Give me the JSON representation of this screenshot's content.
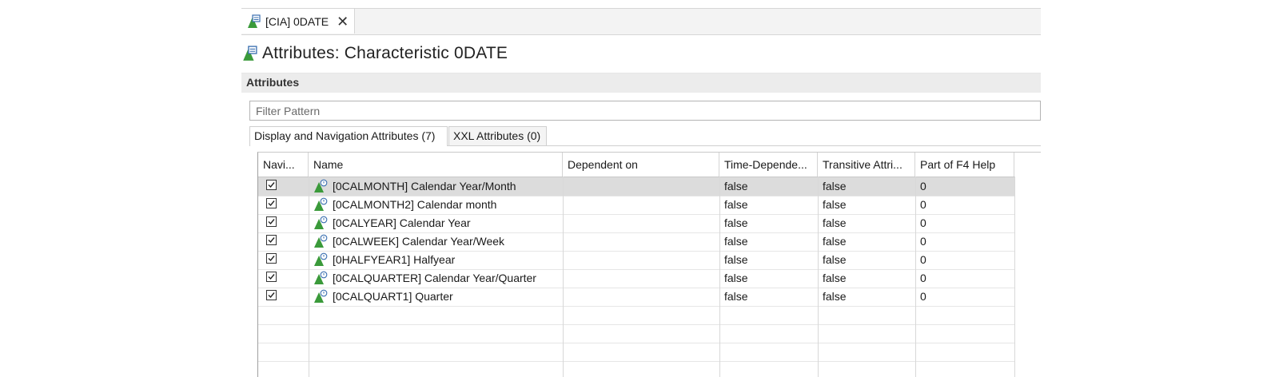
{
  "editor_tab": {
    "label": "[CIA] 0DATE",
    "close_glyph": "✕"
  },
  "page_title": "Attributes: Characteristic 0DATE",
  "section_title": "Attributes",
  "filter": {
    "placeholder": "Filter Pattern"
  },
  "subtabs": [
    {
      "label": "Display and Navigation Attributes (7)",
      "active": true
    },
    {
      "label": "XXL Attributes (0)",
      "active": false
    }
  ],
  "table": {
    "columns": [
      "Navi...",
      "Name",
      "Dependent on",
      "Time-Depende...",
      "Transitive Attri...",
      "Part of F4 Help"
    ],
    "rows": [
      {
        "navigation": true,
        "name": "[0CALMONTH] Calendar Year/Month",
        "dependent_on": "",
        "time_dependent": "false",
        "transitive": "false",
        "f4_help": "0",
        "selected": true
      },
      {
        "navigation": true,
        "name": "[0CALMONTH2] Calendar month",
        "dependent_on": "",
        "time_dependent": "false",
        "transitive": "false",
        "f4_help": "0",
        "selected": false
      },
      {
        "navigation": true,
        "name": "[0CALYEAR] Calendar Year",
        "dependent_on": "",
        "time_dependent": "false",
        "transitive": "false",
        "f4_help": "0",
        "selected": false
      },
      {
        "navigation": true,
        "name": "[0CALWEEK] Calendar Year/Week",
        "dependent_on": "",
        "time_dependent": "false",
        "transitive": "false",
        "f4_help": "0",
        "selected": false
      },
      {
        "navigation": true,
        "name": "[0HALFYEAR1] Halfyear",
        "dependent_on": "",
        "time_dependent": "false",
        "transitive": "false",
        "f4_help": "0",
        "selected": false
      },
      {
        "navigation": true,
        "name": "[0CALQUARTER] Calendar Year/Quarter",
        "dependent_on": "",
        "time_dependent": "false",
        "transitive": "false",
        "f4_help": "0",
        "selected": false
      },
      {
        "navigation": true,
        "name": "[0CALQUART1] Quarter",
        "dependent_on": "",
        "time_dependent": "false",
        "transitive": "false",
        "f4_help": "0",
        "selected": false
      }
    ]
  },
  "icons": {
    "characteristic": "characteristic-icon",
    "attribute": "attribute-icon",
    "checkbox": "checkbox-checked-icon"
  },
  "colors": {
    "icon_green": "#3a9a3a",
    "icon_blue": "#3a6fb0",
    "selected_row": "#dcdcdc"
  }
}
